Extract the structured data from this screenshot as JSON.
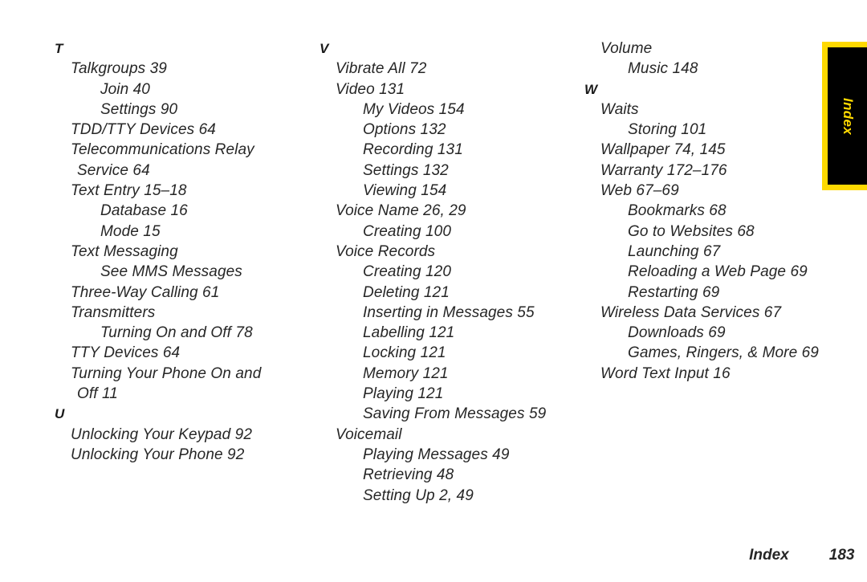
{
  "page": {
    "running_head": "Index",
    "page_number": "183"
  },
  "tab": {
    "label": "Index",
    "background_color": "#000000",
    "border_color": "#ffd900",
    "text_color": "#ffd900"
  },
  "columns": [
    {
      "id": "column-1",
      "lines": [
        {
          "kind": "letter",
          "text": "T"
        },
        {
          "kind": "lvl1",
          "text": "Talkgroups 39"
        },
        {
          "kind": "lvl2",
          "text": "Join 40"
        },
        {
          "kind": "lvl2",
          "text": "Settings 90"
        },
        {
          "kind": "lvl1",
          "text": "TDD/TTY Devices 64"
        },
        {
          "kind": "lvl1",
          "text": "Telecommunications Relay"
        },
        {
          "kind": "cont",
          "text": "Service 64"
        },
        {
          "kind": "lvl1",
          "text": "Text Entry 15–18"
        },
        {
          "kind": "lvl2",
          "text": "Database 16"
        },
        {
          "kind": "lvl2",
          "text": "Mode 15"
        },
        {
          "kind": "lvl1",
          "text": "Text Messaging"
        },
        {
          "kind": "lvl2",
          "text": "See MMS Messages"
        },
        {
          "kind": "lvl1",
          "text": "Three-Way Calling 61"
        },
        {
          "kind": "lvl1",
          "text": "Transmitters"
        },
        {
          "kind": "lvl2",
          "text": "Turning On and Off 78"
        },
        {
          "kind": "lvl1",
          "text": "TTY Devices 64"
        },
        {
          "kind": "lvl1",
          "text": "Turning Your Phone On and"
        },
        {
          "kind": "cont",
          "text": "Off 11"
        },
        {
          "kind": "letter",
          "text": "U"
        },
        {
          "kind": "lvl1",
          "text": "Unlocking Your Keypad 92"
        },
        {
          "kind": "lvl1",
          "text": "Unlocking Your Phone 92"
        }
      ]
    },
    {
      "id": "column-2",
      "lines": [
        {
          "kind": "letter",
          "text": "V"
        },
        {
          "kind": "lvl1",
          "text": "Vibrate All 72"
        },
        {
          "kind": "lvl1",
          "text": "Video 131"
        },
        {
          "kind": "lvl2",
          "text": "My Videos 154"
        },
        {
          "kind": "lvl2",
          "text": "Options 132"
        },
        {
          "kind": "lvl2",
          "text": "Recording 131"
        },
        {
          "kind": "lvl2",
          "text": "Settings 132"
        },
        {
          "kind": "lvl2",
          "text": "Viewing 154"
        },
        {
          "kind": "lvl1",
          "text": "Voice Name 26, 29"
        },
        {
          "kind": "lvl2",
          "text": "Creating 100"
        },
        {
          "kind": "lvl1",
          "text": "Voice Records"
        },
        {
          "kind": "lvl2",
          "text": "Creating 120"
        },
        {
          "kind": "lvl2",
          "text": "Deleting 121"
        },
        {
          "kind": "lvl2",
          "text": "Inserting in Messages 55"
        },
        {
          "kind": "lvl2",
          "text": "Labelling 121"
        },
        {
          "kind": "lvl2",
          "text": "Locking 121"
        },
        {
          "kind": "lvl2",
          "text": "Memory 121"
        },
        {
          "kind": "lvl2",
          "text": "Playing 121"
        },
        {
          "kind": "lvl2",
          "text": "Saving From Messages 59"
        },
        {
          "kind": "lvl1",
          "text": "Voicemail"
        },
        {
          "kind": "lvl2",
          "text": "Playing Messages 49"
        },
        {
          "kind": "lvl2",
          "text": "Retrieving 48"
        },
        {
          "kind": "lvl2",
          "text": "Setting Up 2, 49"
        }
      ]
    },
    {
      "id": "column-3",
      "lines": [
        {
          "kind": "lvl1",
          "text": "Volume"
        },
        {
          "kind": "lvl2",
          "text": "Music 148"
        },
        {
          "kind": "letter",
          "text": "W"
        },
        {
          "kind": "lvl1",
          "text": "Waits"
        },
        {
          "kind": "lvl2",
          "text": "Storing 101"
        },
        {
          "kind": "lvl1",
          "text": "Wallpaper 74, 145"
        },
        {
          "kind": "lvl1",
          "text": "Warranty 172–176"
        },
        {
          "kind": "lvl1",
          "text": "Web 67–69"
        },
        {
          "kind": "lvl2",
          "text": "Bookmarks 68"
        },
        {
          "kind": "lvl2",
          "text": "Go to Websites 68"
        },
        {
          "kind": "lvl2",
          "text": "Launching 67"
        },
        {
          "kind": "lvl2",
          "text": "Reloading a Web Page 69"
        },
        {
          "kind": "lvl2",
          "text": "Restarting 69"
        },
        {
          "kind": "lvl1",
          "text": "Wireless Data Services 67"
        },
        {
          "kind": "lvl2",
          "text": "Downloads 69"
        },
        {
          "kind": "lvl2",
          "text": "Games, Ringers, & More 69"
        },
        {
          "kind": "lvl1",
          "text": "Word Text Input 16"
        }
      ]
    }
  ]
}
